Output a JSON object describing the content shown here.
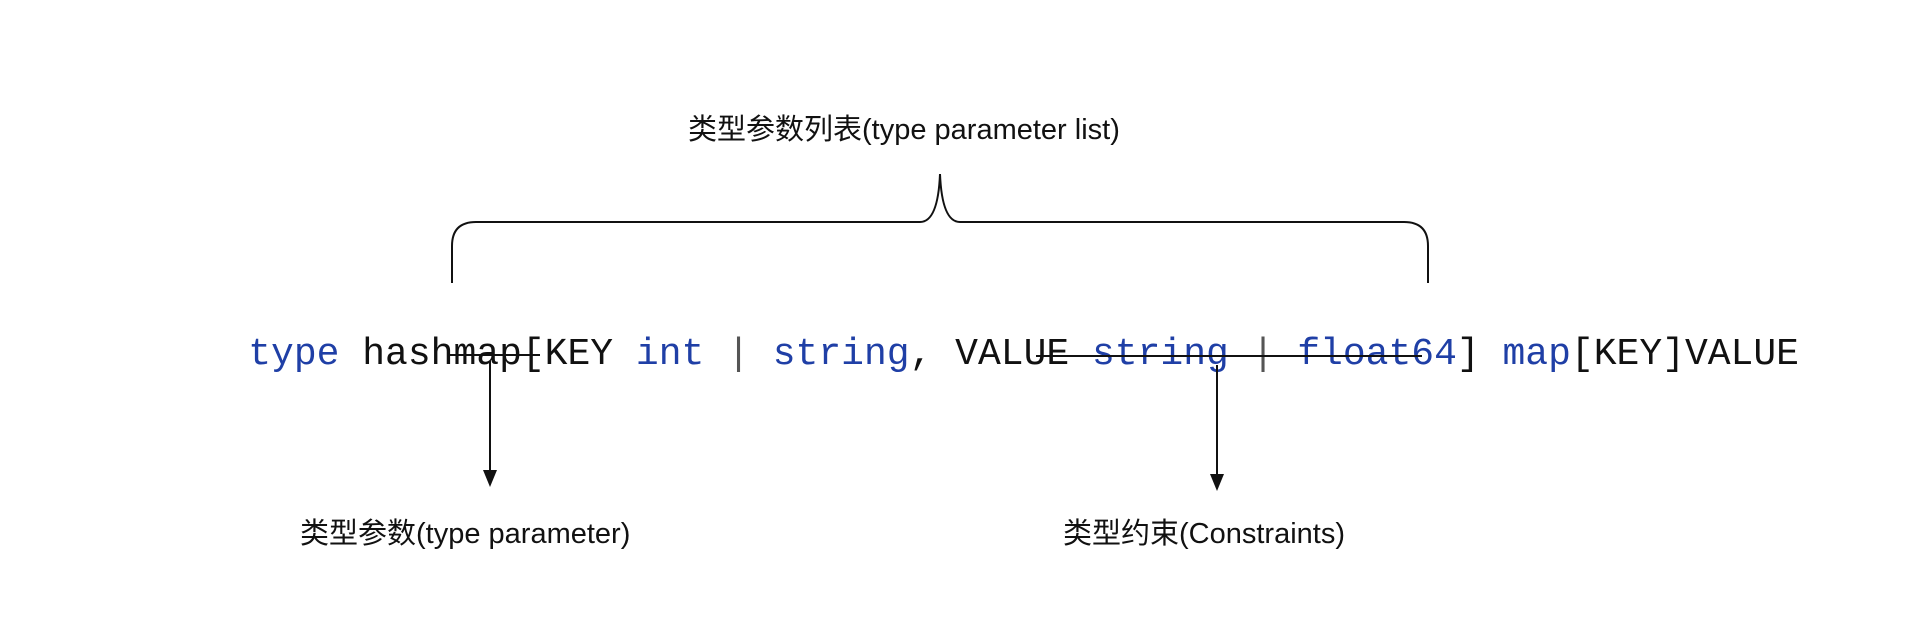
{
  "labels": {
    "type_parameter_list": "类型参数列表(type parameter list)",
    "type_parameter": "类型参数(type parameter)",
    "constraints": "类型约束(Constraints)"
  },
  "code": {
    "tokens": [
      {
        "text": "type",
        "kind": "kw"
      },
      {
        "text": " hashmap[KEY ",
        "kind": "plain"
      },
      {
        "text": "int",
        "kind": "kw"
      },
      {
        "text": " | ",
        "kind": "bar"
      },
      {
        "text": "string",
        "kind": "kw"
      },
      {
        "text": ", VALUE ",
        "kind": "plain"
      },
      {
        "text": "string",
        "kind": "kw"
      },
      {
        "text": " | ",
        "kind": "bar"
      },
      {
        "text": "float64",
        "kind": "kw"
      },
      {
        "text": "] ",
        "kind": "plain"
      },
      {
        "text": "map",
        "kind": "kw"
      },
      {
        "text": "[KEY]VALUE",
        "kind": "plain"
      }
    ]
  },
  "colors": {
    "keyword": "#1f3fa6",
    "text": "#111111",
    "line": "#111111"
  }
}
